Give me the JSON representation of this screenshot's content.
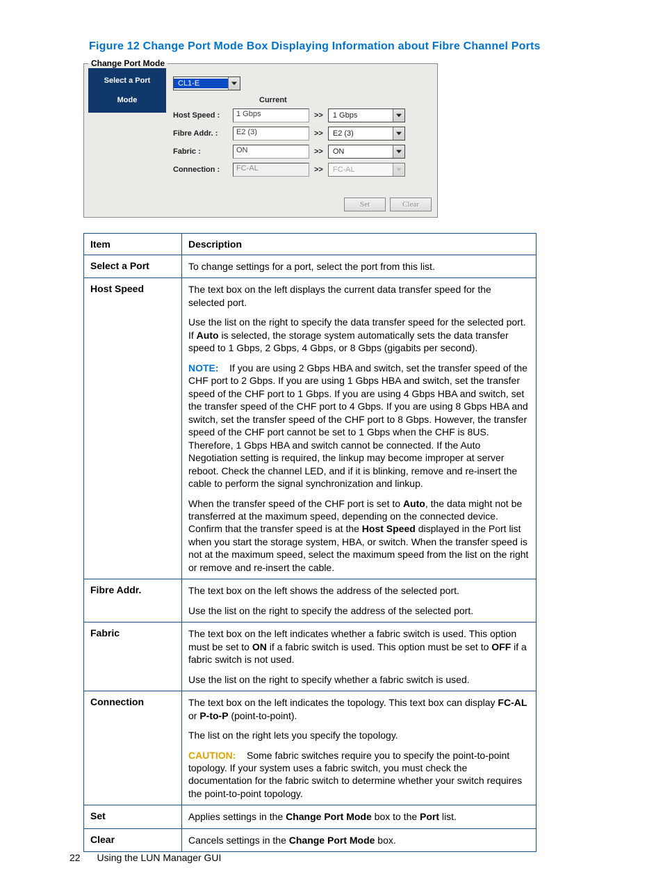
{
  "figure_title": "Figure 12 Change Port Mode Box Displaying Information about Fibre Channel Ports",
  "dialog": {
    "groupbox_label": "Change Port Mode",
    "side_select": "Select a Port",
    "side_mode": "Mode",
    "port_value": "CL1-E",
    "current_header": "Current",
    "labels": {
      "host_speed": "Host Speed :",
      "fibre_addr": "Fibre Addr. :",
      "fabric": "Fabric :",
      "connection": "Connection :"
    },
    "current": {
      "host_speed": "1 Gbps",
      "fibre_addr": "E2 (3)",
      "fabric": "ON",
      "connection": "FC-AL"
    },
    "arrow": ">>",
    "new": {
      "host_speed": "1 Gbps",
      "fibre_addr": "E2 (3)",
      "fabric": "ON",
      "connection": "FC-AL"
    },
    "set_btn": "Set",
    "clear_btn": "Clear"
  },
  "table": {
    "head_item": "Item",
    "head_desc": "Description",
    "rows": {
      "select_port": {
        "item": "Select a Port",
        "p1": "To change settings for a port, select the port from this list."
      },
      "host_speed": {
        "item": "Host Speed",
        "p1": "The text box on the left displays the current data transfer speed for the selected port.",
        "p2a": "Use the list on the right to specify the data transfer speed for the selected port. If ",
        "p2b": "Auto",
        "p2c": " is selected, the storage system automatically sets the data transfer speed to 1 Gbps, 2 Gbps, 4 Gbps, or 8 Gbps (gigabits per second).",
        "note_label": "NOTE:",
        "note_body": " If you are using 2 Gbps HBA and switch, set the transfer speed of the CHF port to 2 Gbps. If you are using 1 Gbps HBA and switch, set the transfer speed of the CHF port to 1 Gbps. If you are using 4 Gbps HBA and switch, set the transfer speed of the CHF port to 4 Gbps. If you are using 8 Gbps HBA and switch, set the transfer speed of the CHF port to 8 Gbps. However, the transfer speed of the CHF port cannot be set to 1 Gbps when the CHF is 8US. Therefore, 1 Gbps HBA and switch cannot be connected. If the Auto Negotiation setting is required, the linkup may become improper at server reboot. Check the channel LED, and if it is blinking, remove and re-insert the cable to perform the signal synchronization and linkup.",
        "p4a": "When the transfer speed of the CHF port is set to ",
        "p4b": "Auto",
        "p4c": ", the data might not be transferred at the maximum speed, depending on the connected device. Confirm that the transfer speed is at the ",
        "p4d": "Host Speed",
        "p4e": " displayed in the Port list when you start the storage system, HBA, or switch. When the transfer speed is not at the maximum speed, select the maximum speed from the list on the right or remove and re-insert the cable."
      },
      "fibre_addr": {
        "item": "Fibre Addr.",
        "p1": "The text box on the left shows the address of the selected port.",
        "p2": "Use the list on the right to specify the address of the selected port."
      },
      "fabric": {
        "item": "Fabric",
        "p1a": "The text box on the left indicates whether a fabric switch is used. This option must be set to ",
        "p1b": "ON",
        "p1c": " if a fabric switch is used. This option must be set to ",
        "p1d": "OFF",
        "p1e": " if a fabric switch is not used.",
        "p2": "Use the list on the right to specify whether a fabric switch is used."
      },
      "connection": {
        "item": "Connection",
        "p1a": "The text box on the left indicates the topology. This text box can display ",
        "p1b": "FC-AL",
        "p1c": " or ",
        "p1d": "P-to-P",
        "p1e": " (point-to-point).",
        "p2": "The list on the right lets you specify the topology.",
        "caut_label": "CAUTION:",
        "caut_body": " Some fabric switches require you to specify the point-to-point topology. If your system uses a fabric switch, you must check the documentation for the fabric switch to determine whether your switch requires the point-to-point topology."
      },
      "set": {
        "item": "Set",
        "p1a": "Applies settings in the ",
        "p1b": "Change Port Mode",
        "p1c": " box to the ",
        "p1d": "Port",
        "p1e": " list."
      },
      "clear": {
        "item": "Clear",
        "p1a": "Cancels settings in the ",
        "p1b": "Change Port Mode",
        "p1c": " box."
      }
    }
  },
  "footer": {
    "page_num": "22",
    "section": "Using the LUN Manager GUI"
  }
}
